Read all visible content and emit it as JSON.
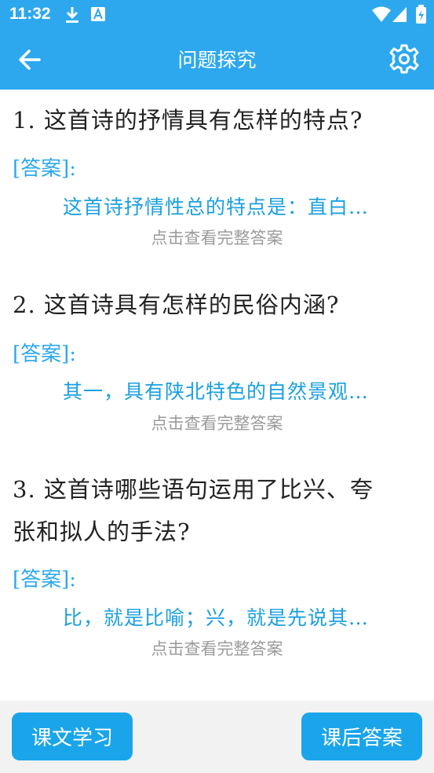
{
  "status_bar": {
    "time": "11:32",
    "icons": [
      "download-icon",
      "accessibility-a-icon",
      "wifi-icon",
      "signal-icon",
      "battery-icon"
    ]
  },
  "app_bar": {
    "title": "问题探究",
    "back_icon": "arrow-left-icon",
    "settings_icon": "gear-icon"
  },
  "questions": [
    {
      "question": "1. 这首诗的抒情具有怎样的特点?",
      "answer_label": "[答案]:",
      "answer_preview": "这首诗抒情性总的特点是：直白…",
      "view_full": "点击查看完整答案"
    },
    {
      "question": "2. 这首诗具有怎样的民俗内涵?",
      "answer_label": "[答案]:",
      "answer_preview": "其一，具有陕北特色的自然景观…",
      "view_full": "点击查看完整答案"
    },
    {
      "question_line1": "3. 这首诗哪些语句运用了比兴、夸",
      "question_line2": "张和拟人的手法?",
      "answer_label": "[答案]:",
      "answer_preview": "比，就是比喻；兴，就是先说其…",
      "view_full": "点击查看完整答案"
    }
  ],
  "bottom_bar": {
    "left_button": "课文学习",
    "right_button": "课后答案"
  },
  "colors": {
    "primary": "#2da8ee",
    "button": "#1aa5ea",
    "answer_text": "#1a9fe0",
    "muted": "#9b9b9b"
  }
}
